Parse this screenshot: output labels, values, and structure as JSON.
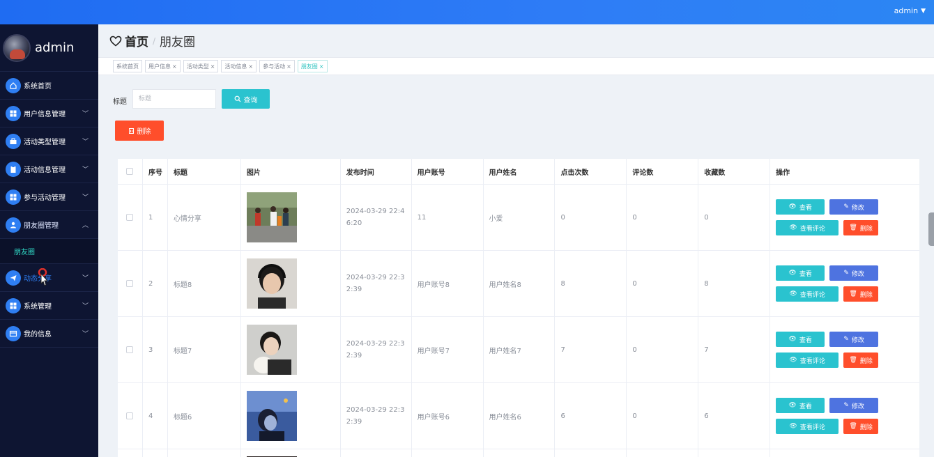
{
  "topbar": {
    "user": "admin"
  },
  "sidebar": {
    "username": "admin",
    "items": [
      {
        "label": "系统首页",
        "icon": "home-icon",
        "has_arrow": false
      },
      {
        "label": "用户信息管理",
        "icon": "grid-icon",
        "has_arrow": true
      },
      {
        "label": "活动类型管理",
        "icon": "briefcase-icon",
        "has_arrow": true
      },
      {
        "label": "活动信息管理",
        "icon": "clipboard-icon",
        "has_arrow": true
      },
      {
        "label": "参与活动管理",
        "icon": "grid-icon",
        "has_arrow": true
      },
      {
        "label": "朋友圈管理",
        "icon": "user-icon",
        "has_arrow": true,
        "expanded": true
      },
      {
        "label": "动态分享",
        "icon": "send-icon",
        "has_arrow": true
      },
      {
        "label": "系统管理",
        "icon": "grid-icon",
        "has_arrow": true
      },
      {
        "label": "我的信息",
        "icon": "card-icon",
        "has_arrow": true
      }
    ],
    "submenu_label": "朋友圈"
  },
  "breadcrumb": {
    "home": "首页",
    "separator": "/",
    "current": "朋友圈"
  },
  "tags": [
    "系统首页",
    "用户信息",
    "活动类型",
    "活动信息",
    "参与活动",
    "朋友圈"
  ],
  "search": {
    "label": "标题",
    "placeholder": "标题",
    "button": "查询"
  },
  "delete_button": "删除",
  "table": {
    "headers": [
      "序号",
      "标题",
      "图片",
      "发布时间",
      "用户账号",
      "用户姓名",
      "点击次数",
      "评论数",
      "收藏数",
      "操作"
    ],
    "rows": [
      {
        "no": "1",
        "title": "心情分享",
        "time": "2024-03-29 22:46:20",
        "account": "11",
        "name": "小爱",
        "clicks": "0",
        "comments": "0",
        "favorites": "0"
      },
      {
        "no": "2",
        "title": "标题8",
        "time": "2024-03-29 22:32:39",
        "account": "用户账号8",
        "name": "用户姓名8",
        "clicks": "8",
        "comments": "0",
        "favorites": "8"
      },
      {
        "no": "3",
        "title": "标题7",
        "time": "2024-03-29 22:32:39",
        "account": "用户账号7",
        "name": "用户姓名7",
        "clicks": "7",
        "comments": "0",
        "favorites": "7"
      },
      {
        "no": "4",
        "title": "标题6",
        "time": "2024-03-29 22:32:39",
        "account": "用户账号6",
        "name": "用户姓名6",
        "clicks": "6",
        "comments": "0",
        "favorites": "6"
      }
    ],
    "actions": {
      "view": "查看",
      "edit": "修改",
      "comment": "查看评论",
      "delete": "删除"
    }
  },
  "colors": {
    "primary": "#2f7ff3",
    "cyan": "#2ac3cf",
    "danger": "#ff4e2b",
    "edit": "#4e73e0",
    "sidebar_bg": "#0e1532"
  }
}
